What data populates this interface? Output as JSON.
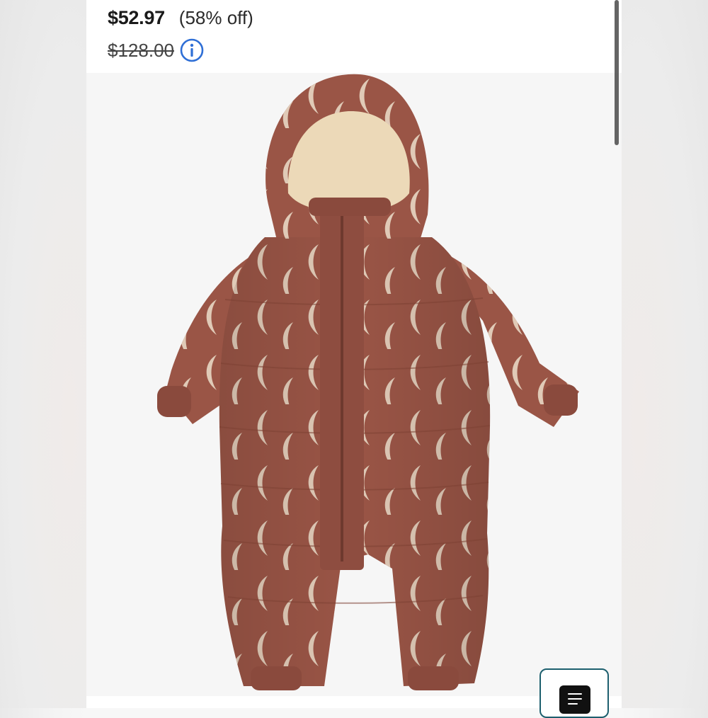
{
  "product": {
    "price": "$52.97",
    "discount": "(58% off)",
    "original_price": "$128.00"
  },
  "icons": {
    "info": "info-circle-icon",
    "menu": "list-menu-icon"
  },
  "colors": {
    "accent_blue": "#2f6fd6",
    "suit": "#9a5546",
    "moon": "#e8d8c4",
    "lining": "#ecd9b8",
    "button_border": "#1d5f6e"
  }
}
